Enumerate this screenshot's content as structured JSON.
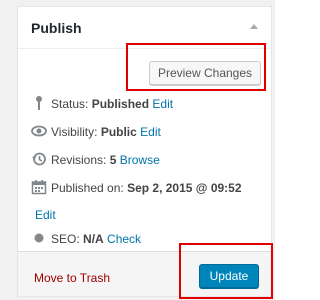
{
  "publish_box": {
    "title": "Publish",
    "preview_button": "Preview Changes",
    "status": {
      "label": "Status:",
      "value": "Published",
      "edit": "Edit"
    },
    "visibility": {
      "label": "Visibility:",
      "value": "Public",
      "edit": "Edit"
    },
    "revisions": {
      "label": "Revisions:",
      "value": "5",
      "browse": "Browse"
    },
    "published_on": {
      "label": "Published on:",
      "value": "Sep 2, 2015 @ 09:52",
      "edit": "Edit"
    },
    "seo": {
      "label": "SEO:",
      "value": "N/A",
      "check": "Check"
    },
    "trash_link": "Move to Trash",
    "update_button": "Update"
  },
  "icons": {
    "status": "pin-icon",
    "visibility": "eye-icon",
    "revisions": "history-icon",
    "published_on": "calendar-icon",
    "seo": "circle-icon",
    "toggle": "triangle-up-icon"
  },
  "colors": {
    "link": "#0073aa",
    "trash": "#a00000",
    "primary_button": "#0085ba",
    "highlight": "#e00000"
  }
}
